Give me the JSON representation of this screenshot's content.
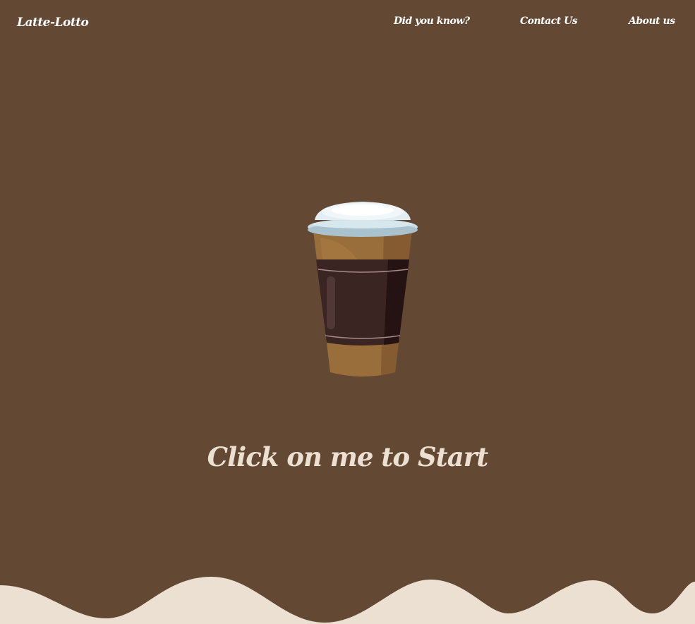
{
  "header": {
    "brand": "Latte-Lotto",
    "nav": {
      "did_you_know": "Did you know?",
      "contact": "Contact Us",
      "about": "About us"
    }
  },
  "hero": {
    "cup_icon": "coffee-cup-icon",
    "cta": "Click on me to Start"
  },
  "colors": {
    "background": "#634933",
    "cream": "#ebe0d2",
    "nav_text": "#ffffff"
  }
}
